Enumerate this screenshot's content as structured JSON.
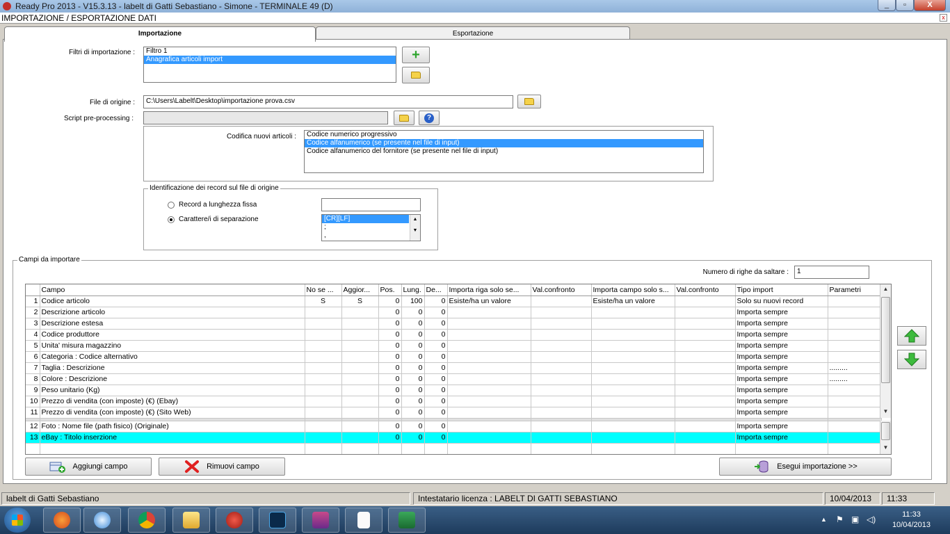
{
  "window": {
    "title": "Ready Pro 2013 - V15.3.13 - labelt di Gatti Sebastiano - Simone - TERMINALE 49 (D)",
    "min_label": "_",
    "max_label": "▫",
    "close_label": "X"
  },
  "dialog": {
    "title": "IMPORTAZIONE / ESPORTAZIONE DATI",
    "close_label": "x"
  },
  "tabs": [
    {
      "label": "Importazione",
      "active": true
    },
    {
      "label": "Esportazione",
      "active": false
    }
  ],
  "filters": {
    "label": "Filtri di importazione :",
    "items": [
      "Filtro 1",
      "Anagrafica articoli import"
    ],
    "selected_index": 1
  },
  "source_file": {
    "label": "File di origine :",
    "value": "C:\\Users\\Labelt\\Desktop\\importazione prova.csv"
  },
  "script": {
    "label": "Script pre-processing :",
    "value": "",
    "help_label": "?"
  },
  "codifica": {
    "label": "Codifica nuovi articoli :",
    "items": [
      "Codice numerico progressivo",
      "Codice alfanumerico (se presente nel file di input)",
      "Codice alfanumerico del fornitore (se presente nel file di input)"
    ],
    "selected_index": 1
  },
  "identificazione": {
    "title": "Identificazione dei record sul file di origine",
    "option_fixed": "Record a lunghezza fissa",
    "option_sep": "Carattere/i di separazione",
    "selected": "sep",
    "fixed_value": "",
    "separators": [
      "[CR][LF]",
      ";",
      ","
    ],
    "separator_selected": 0
  },
  "campi": {
    "title": "Campi da importare",
    "skip_label": "Numero di righe da saltare :",
    "skip_value": "1",
    "columns": [
      "Campo",
      "No se ...",
      "Aggior...",
      "Pos.",
      "Lung.",
      "De...",
      "Importa riga solo se...",
      "Val.confronto",
      "Importa campo solo s...",
      "Val.confronto",
      "Tipo import",
      "Parametri"
    ],
    "rows": [
      [
        "1",
        "Codice articolo",
        "S",
        "S",
        "0",
        "100",
        "0",
        "Esiste/ha un valore",
        "",
        "Esiste/ha un valore",
        "",
        "Solo su nuovi record",
        ""
      ],
      [
        "2",
        "Descrizione articolo",
        "",
        "",
        "0",
        "0",
        "0",
        "",
        "",
        "",
        "",
        "Importa sempre",
        ""
      ],
      [
        "3",
        "Descrizione estesa",
        "",
        "",
        "0",
        "0",
        "0",
        "",
        "",
        "",
        "",
        "Importa sempre",
        ""
      ],
      [
        "4",
        "Codice produttore",
        "",
        "",
        "0",
        "0",
        "0",
        "",
        "",
        "",
        "",
        "Importa sempre",
        ""
      ],
      [
        "5",
        "Unita' misura magazzino",
        "",
        "",
        "0",
        "0",
        "0",
        "",
        "",
        "",
        "",
        "Importa sempre",
        ""
      ],
      [
        "6",
        "Categoria : Codice alternativo",
        "",
        "",
        "0",
        "0",
        "0",
        "",
        "",
        "",
        "",
        "Importa sempre",
        ""
      ],
      [
        "7",
        "Taglia : Descrizione",
        "",
        "",
        "0",
        "0",
        "0",
        "",
        "",
        "",
        "",
        "Importa sempre",
        "........."
      ],
      [
        "8",
        "Colore : Descrizione",
        "",
        "",
        "0",
        "0",
        "0",
        "",
        "",
        "",
        "",
        "Importa sempre",
        "........."
      ],
      [
        "9",
        "Peso unitario (Kg)",
        "",
        "",
        "0",
        "0",
        "0",
        "",
        "",
        "",
        "",
        "Importa sempre",
        ""
      ],
      [
        "10",
        "Prezzo di vendita (con imposte) (€) (Ebay)",
        "",
        "",
        "0",
        "0",
        "0",
        "",
        "",
        "",
        "",
        "Importa sempre",
        ""
      ],
      [
        "11",
        "Prezzo di vendita (con imposte) (€) (Sito Web)",
        "",
        "",
        "0",
        "0",
        "0",
        "",
        "",
        "",
        "",
        "Importa sempre",
        ""
      ]
    ],
    "frozen_rows": [
      [
        "12",
        "Foto : Nome file (path fisico) (Originale)",
        "",
        "",
        "0",
        "0",
        "0",
        "",
        "",
        "",
        "",
        "Importa sempre",
        ""
      ],
      [
        "13",
        "eBay : Titolo inserzione",
        "",
        "",
        "0",
        "0",
        "0",
        "",
        "",
        "",
        "",
        "Importa sempre",
        ""
      ]
    ],
    "highlight_row": 13
  },
  "buttons": {
    "add": "Aggiungi campo",
    "remove": "Rimuovi campo",
    "run": "Esegui importazione >>"
  },
  "status": {
    "company": "labelt di Gatti Sebastiano",
    "license": "Intestatario licenza : LABELT DI GATTI SEBASTIANO",
    "date": "10/04/2013",
    "time": "11:33"
  },
  "taskbar": {
    "apps": [
      "firefox-icon",
      "safari-icon",
      "chrome-icon",
      "explorer-icon",
      "readypro-icon",
      "photoshop-icon",
      "winrar-icon",
      "document-icon",
      "excel-icon"
    ],
    "clock_time": "11:33",
    "clock_date": "10/04/2013"
  },
  "colors": {
    "selection": "#3399ff",
    "highlight_row": "#00ffff",
    "green_arrow": "#2fa52f"
  }
}
